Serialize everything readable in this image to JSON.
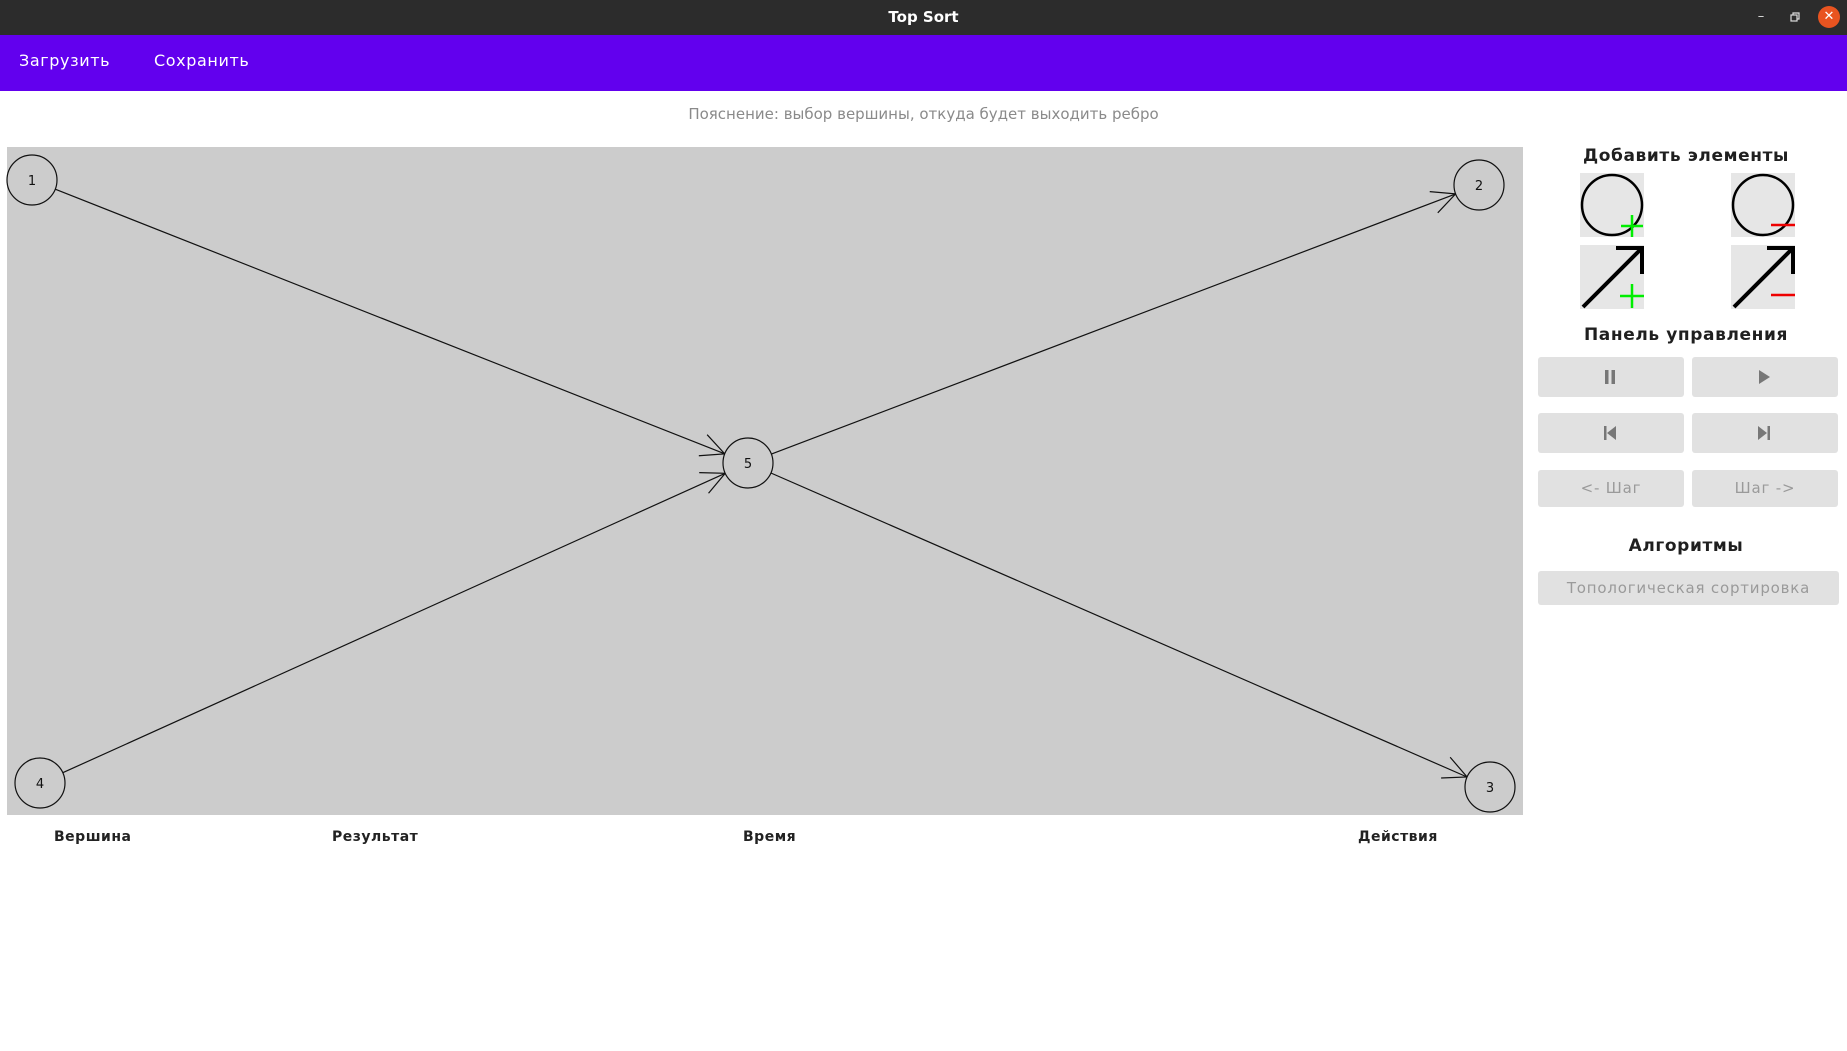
{
  "window": {
    "title": "Top Sort"
  },
  "menu": {
    "load_label": "Загрузить",
    "save_label": "Сохранить"
  },
  "hint": "Пояснение: выбор вершины, откуда будет выходить ребро",
  "graph": {
    "nodes": [
      {
        "id": "1",
        "label": "1"
      },
      {
        "id": "2",
        "label": "2"
      },
      {
        "id": "3",
        "label": "3"
      },
      {
        "id": "4",
        "label": "4"
      },
      {
        "id": "5",
        "label": "5"
      }
    ],
    "edges": [
      {
        "from": "1",
        "to": "5"
      },
      {
        "from": "4",
        "to": "5"
      },
      {
        "from": "5",
        "to": "2"
      },
      {
        "from": "5",
        "to": "3"
      }
    ]
  },
  "table": {
    "columns": [
      "Вершина",
      "Результат",
      "Время",
      "Действия"
    ]
  },
  "sidebar": {
    "add_title": "Добавить элементы",
    "tools": [
      {
        "name": "add-vertex",
        "icon": "circle-plus-icon"
      },
      {
        "name": "remove-vertex",
        "icon": "circle-minus-icon"
      },
      {
        "name": "add-edge",
        "icon": "arrow-plus-icon"
      },
      {
        "name": "remove-edge",
        "icon": "arrow-minus-icon"
      }
    ],
    "control_title": "Панель управления",
    "controls": {
      "pause_icon": "pause-icon",
      "play_icon": "play-icon",
      "skip_back_icon": "skip-to-start-icon",
      "skip_forward_icon": "skip-to-end-icon",
      "step_back_label": "<- Шаг",
      "step_forward_label": "Шаг ->"
    },
    "algo_title": "Алгоритмы",
    "algo_button": "Топологическая сортировка"
  },
  "colors": {
    "menubar": "#6200ee",
    "canvas": "#cccccc",
    "plus": "#00ee00",
    "minus": "#ee0000",
    "close_button": "#e95420"
  }
}
